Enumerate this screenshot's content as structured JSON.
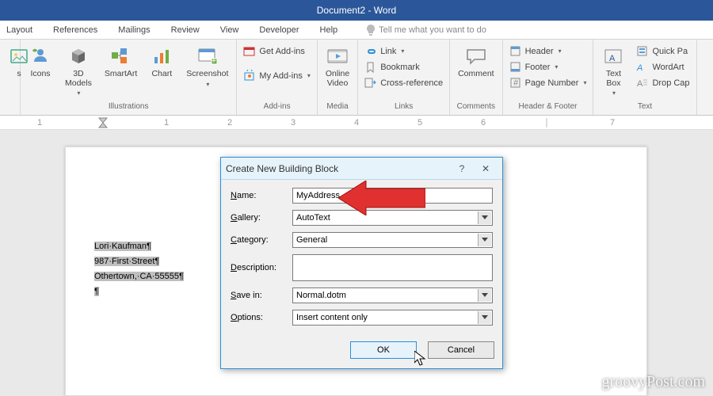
{
  "title": "Document2 - Word",
  "menu": {
    "layout": "Layout",
    "references": "References",
    "mailings": "Mailings",
    "review": "Review",
    "view": "View",
    "developer": "Developer",
    "help": "Help",
    "tellme": "Tell me what you want to do"
  },
  "ribbon": {
    "illustrations": {
      "label": "Illustrations",
      "icons": "Icons",
      "models": "3D\nModels",
      "smartart": "SmartArt",
      "chart": "Chart",
      "screenshot": "Screenshot"
    },
    "addins": {
      "label": "Add-ins",
      "get": "Get Add-ins",
      "my": "My Add-ins"
    },
    "media": {
      "label": "Media",
      "video": "Online\nVideo"
    },
    "links": {
      "label": "Links",
      "link": "Link",
      "bookmark": "Bookmark",
      "cross": "Cross-reference"
    },
    "comments": {
      "label": "Comments",
      "comment": "Comment"
    },
    "hf": {
      "label": "Header & Footer",
      "header": "Header",
      "footer": "Footer",
      "page": "Page Number"
    },
    "text": {
      "label": "Text",
      "textbox": "Text\nBox",
      "quick": "Quick Pa",
      "wordart": "WordArt",
      "drop": "Drop Cap"
    }
  },
  "document": {
    "line1": "Lori·Kaufman¶",
    "line2": "987·First·Street¶",
    "line3": "Othertown,·CA·55555¶",
    "line4": "¶"
  },
  "dialog": {
    "title": "Create New Building Block",
    "labels": {
      "name": "Name:",
      "gallery": "Gallery:",
      "category": "Category:",
      "description": "Description:",
      "savein": "Save in:",
      "options": "Options:"
    },
    "values": {
      "name": "MyAddress",
      "gallery": "AutoText",
      "category": "General",
      "description": "",
      "savein": "Normal.dotm",
      "options": "Insert content only"
    },
    "ok": "OK",
    "cancel": "Cancel"
  },
  "watermark": "groovyPost.com"
}
